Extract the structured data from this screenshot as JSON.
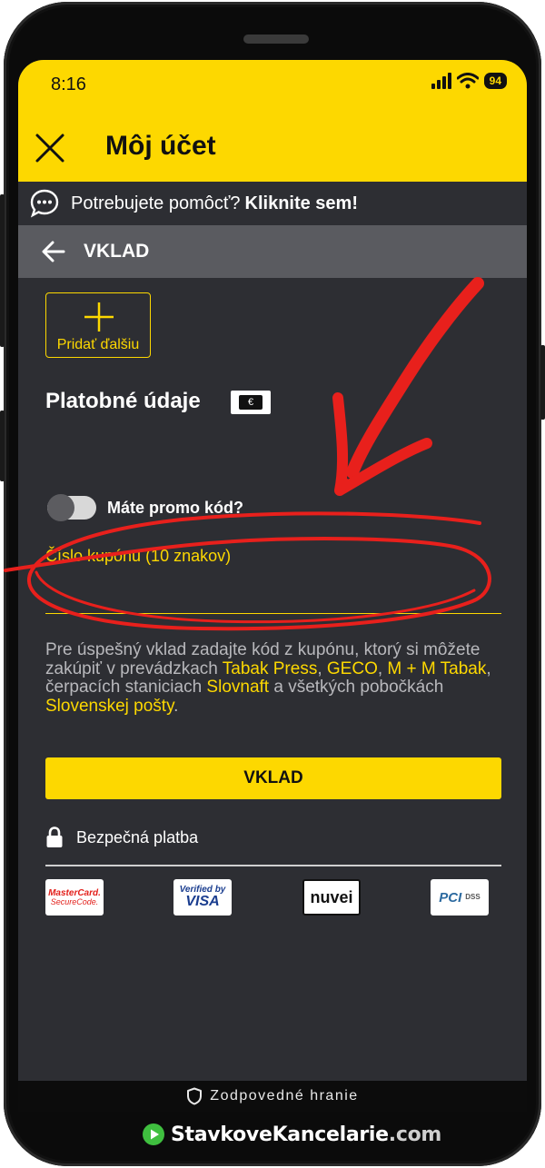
{
  "status": {
    "time": "8:16",
    "battery": "94"
  },
  "header": {
    "title": "Môj účet"
  },
  "help": {
    "text": "Potrebujete pomôcť?",
    "link": "Kliknite sem!"
  },
  "section": {
    "title": "VKLAD"
  },
  "add_card": {
    "label": "Pridať ďalšiu"
  },
  "payment": {
    "heading": "Platobné údaje",
    "currency_symbol": "€"
  },
  "promo": {
    "label": "Máte promo kód?",
    "enabled": false
  },
  "coupon": {
    "label": "Číslo kupónu (10 znakov)",
    "value": ""
  },
  "info": {
    "part1": "Pre úspešný vklad zadajte kód z kupónu, ktorý si môžete zakúpiť v prevádzkach ",
    "link1": "Tabak Press",
    "sep1": ", ",
    "link2": "GECO",
    "sep2": ", ",
    "link3": "M + M Tabak",
    "part2": ", čerpacích staniciach ",
    "link4": "Slovnaft",
    "part3": " a všetkých pobočkách ",
    "link5": "Slovenskej pošty",
    "part4": "."
  },
  "deposit_button": {
    "label": "VKLAD"
  },
  "secure": {
    "label": "Bezpečná platba"
  },
  "logos": {
    "mastercard_1": "MasterCard.",
    "mastercard_2": "SecureCode.",
    "visa_1": "Verified by",
    "visa_2": "VISA",
    "nuvei": "nuvei",
    "pci_1": "PCI",
    "pci_2": "DSS"
  },
  "footer": {
    "responsible": "Zodpovedné hranie"
  },
  "brand": {
    "name": "StavkoveKancelarie",
    "suffix": ".com"
  },
  "colors": {
    "accent": "#fdd800",
    "background": "#2d2e33",
    "annotation": "#e8201c"
  }
}
